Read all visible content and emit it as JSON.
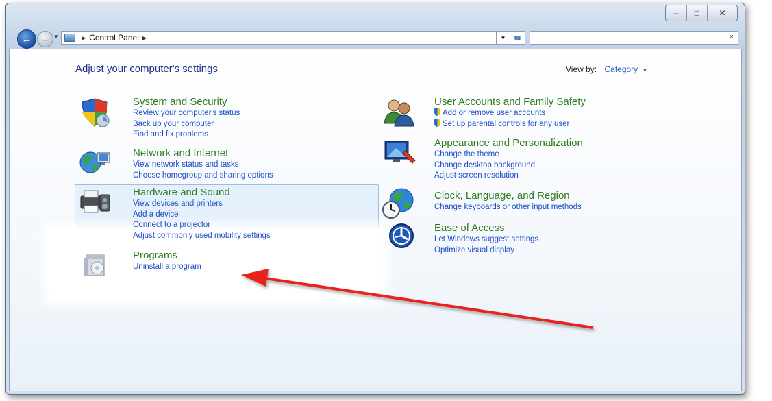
{
  "window": {
    "controls": {
      "minimize": "–",
      "maximize": "□",
      "close": "✕"
    }
  },
  "navbar": {
    "back_icon": "←",
    "forward_icon": "→",
    "address_path": "Control Panel",
    "separator": "▶",
    "dropdown": "▼",
    "refresh": "⇆",
    "search_placeholder": "",
    "search_clear": "×"
  },
  "main": {
    "heading": "Adjust your computer's settings",
    "view_by_label": "View by:",
    "view_by_value": "Category",
    "view_by_caret": "▼"
  },
  "categories_left": [
    {
      "title": "System and Security",
      "links": [
        "Review your computer's status",
        "Back up your computer",
        "Find and fix problems"
      ]
    },
    {
      "title": "Network and Internet",
      "links": [
        "View network status and tasks",
        "Choose homegroup and sharing options"
      ]
    },
    {
      "title": "Hardware and Sound",
      "links": [
        "View devices and printers",
        "Add a device",
        "Connect to a projector",
        "Adjust commonly used mobility settings"
      ]
    },
    {
      "title": "Programs",
      "links": [
        "Uninstall a program"
      ]
    }
  ],
  "categories_right": [
    {
      "title": "User Accounts and Family Safety",
      "links": [
        "Add or remove user accounts",
        "Set up parental controls for any user"
      ]
    },
    {
      "title": "Appearance and Personalization",
      "links": [
        "Change the theme",
        "Change desktop background",
        "Adjust screen resolution"
      ]
    },
    {
      "title": "Clock, Language, and Region",
      "links": [
        "Change keyboards or other input methods"
      ]
    },
    {
      "title": "Ease of Access",
      "links": [
        "Let Windows suggest settings",
        "Optimize visual display"
      ]
    }
  ],
  "colors": {
    "category_title": "#2f7d1e",
    "link": "#1f4fc7",
    "heading": "#1e3287",
    "annotation_arrow": "#e8231d"
  },
  "icons": [
    "shield-icon",
    "network-globe-icon",
    "printer-icon",
    "programs-box-icon",
    "users-icon",
    "monitor-paint-icon",
    "clock-globe-icon",
    "ease-of-access-icon"
  ]
}
